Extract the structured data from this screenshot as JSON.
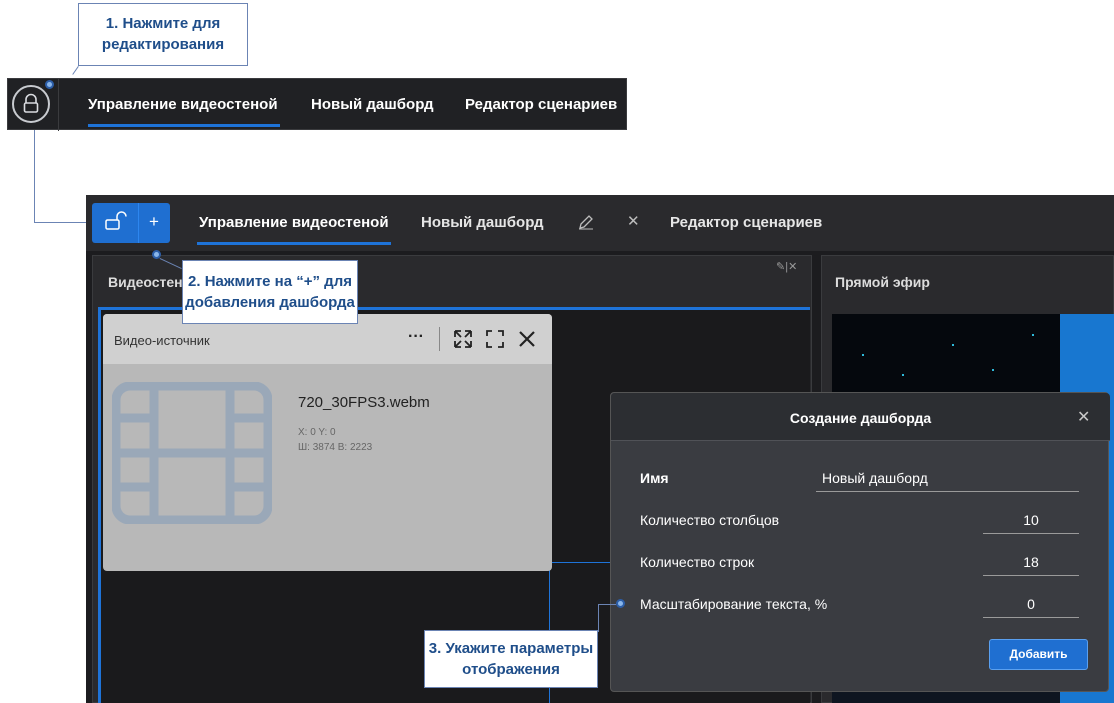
{
  "callouts": {
    "step1_line1": "1. Нажмите для",
    "step1_line2": "редактирования",
    "step2_line1": "2. Нажмите на “+” для",
    "step2_line2": "добавления дашборда",
    "step3_line1": "3. Укажите параметры",
    "step3_line2": "отображения"
  },
  "top_bar": {
    "tabs": [
      "Управление видеостеной",
      "Новый дашборд",
      "Редактор сценариев"
    ],
    "active_tab_index": 0
  },
  "app": {
    "plus_label": "+",
    "tabs": [
      "Управление видеостеной",
      "Новый дашборд",
      "Редактор сценариев"
    ],
    "active_tab_index": 0,
    "left_panel_title": "Видеостен",
    "right_panel_title": "Прямой эфир",
    "video_card": {
      "title": "Видео-источник",
      "more_label": "···",
      "filename": "720_30FPS3.webm",
      "position": "X: 0 Y: 0",
      "size": "Ш: 3874 В: 2223"
    }
  },
  "dialog": {
    "title": "Создание дашборда",
    "close_label": "✕",
    "fields": [
      {
        "label": "Имя",
        "value": "Новый дашборд"
      },
      {
        "label": "Количество столбцов",
        "value": "10"
      },
      {
        "label": "Количество строк",
        "value": "18"
      },
      {
        "label": "Масштабирование текста, %",
        "value": "0"
      }
    ],
    "add_button": "Добавить"
  },
  "colors": {
    "accent": "#1e73d8",
    "callout_text": "#1f4e8a",
    "dark_bg": "#1c1c1f"
  },
  "icons": [
    "lock-icon",
    "unlock-icon",
    "plus-icon",
    "pencil-icon",
    "close-icon",
    "more-icon",
    "expand-icon",
    "fullscreen-icon",
    "film-icon"
  ]
}
